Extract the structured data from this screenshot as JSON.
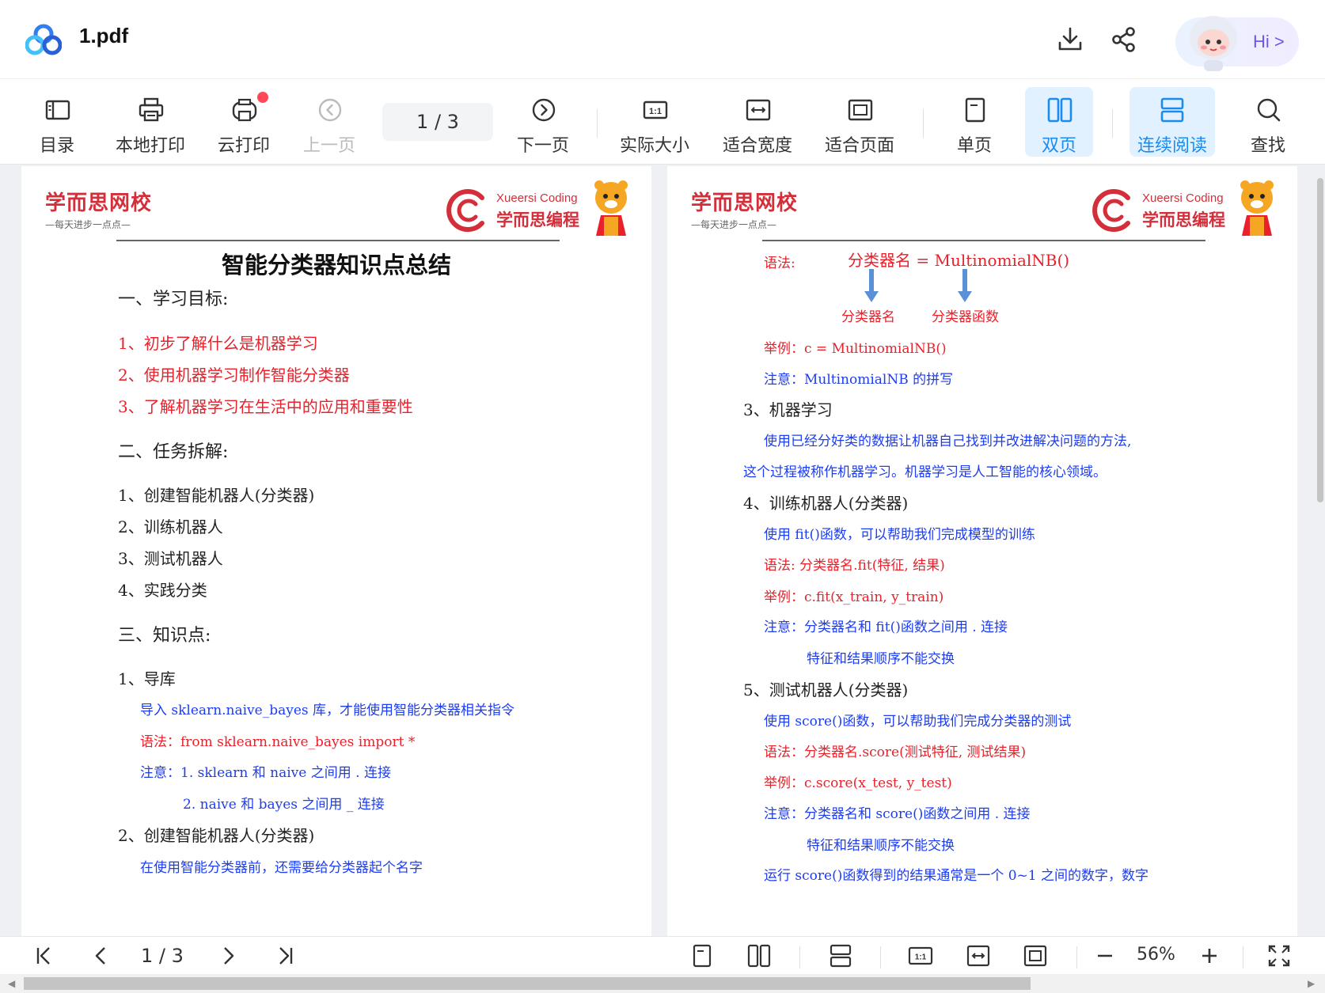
{
  "header": {
    "file_name": "1.pdf",
    "ai_label": "Hi >"
  },
  "toolbar": {
    "toc": "目录",
    "local_print": "本地打印",
    "cloud_print": "云打印",
    "prev_page": "上一页",
    "page_indicator": "1  / 3",
    "next_page": "下一页",
    "actual_size": "实际大小",
    "fit_width": "适合宽度",
    "fit_page": "适合页面",
    "single_page": "单页",
    "double_page": "双页",
    "continuous_read": "连续阅读",
    "search": "查找"
  },
  "document": {
    "brand_name": "学而思网校",
    "brand_slogan": "—每天进步一点点—",
    "brand_coding_en": "Xueersi Coding",
    "brand_coding_cn": "学而思编程",
    "page1": {
      "title": "智能分类器知识点总结",
      "sec1": "一、学习目标:",
      "goal1": "1、初步了解什么是机器学习",
      "goal2": "2、使用机器学习制作智能分类器",
      "goal3": "3、了解机器学习在生活中的应用和重要性",
      "sec2": "二、任务拆解:",
      "task1": "1、创建智能机器人(分类器)",
      "task2": "2、训练机器人",
      "task3": "3、测试机器人",
      "task4": "4、实践分类",
      "sec3": "三、知识点:",
      "k1_title": "1、导库",
      "k1_desc": "导入 sklearn.naive_bayes 库，才能使用智能分类器相关指令",
      "k1_syntax": "语法：from sklearn.naive_bayes import *",
      "k1_note1": "注意：1. sklearn 和 naive 之间用 . 连接",
      "k1_note2": "2. naive 和 bayes 之间用 _ 连接",
      "k2_title": "2、创建智能机器人(分类器)",
      "k2_desc": "在使用智能分类器前，还需要给分类器起个名字"
    },
    "page2": {
      "syntax_label": "语法:",
      "syntax_expr": "分类器名 = MultinomialNB()",
      "arrow_label1": "分类器名",
      "arrow_label2": "分类器函数",
      "example": "举例：c = MultinomialNB()",
      "note": "注意：MultinomialNB 的拼写",
      "k3_title": "3、机器学习",
      "k3_desc1": "使用已经分好类的数据让机器自己找到并改进解决问题的方法,",
      "k3_desc2": "这个过程被称作机器学习。机器学习是人工智能的核心领域。",
      "k4_title": "4、训练机器人(分类器)",
      "k4_desc": "使用 fit()函数，可以帮助我们完成模型的训练",
      "k4_syntax": "语法:  分类器名.fit(特征, 结果)",
      "k4_example": "举例：c.fit(x_train, y_train)",
      "k4_note1": "注意：分类器名和 fit()函数之间用 . 连接",
      "k4_note2": "特征和结果顺序不能交换",
      "k5_title": "5、测试机器人(分类器)",
      "k5_desc": "使用 score()函数，可以帮助我们完成分类器的测试",
      "k5_syntax": "语法：分类器名.score(测试特征, 测试结果)",
      "k5_example": "举例：c.score(x_test, y_test)",
      "k5_note1": "注意：分类器名和 score()函数之间用 . 连接",
      "k5_note2": "特征和结果顺序不能交换",
      "k5_run": "运行 score()函数得到的结果通常是一个 0~1 之间的数字，数字"
    }
  },
  "bottombar": {
    "page_indicator": "1 / 3",
    "zoom": "56%"
  },
  "colors": {
    "accent": "#1b8bf0",
    "active_bg": "#e2f1ff",
    "doc_red": "#e8212b",
    "doc_blue": "#1d3df0",
    "brand_red": "#d32f3a"
  }
}
